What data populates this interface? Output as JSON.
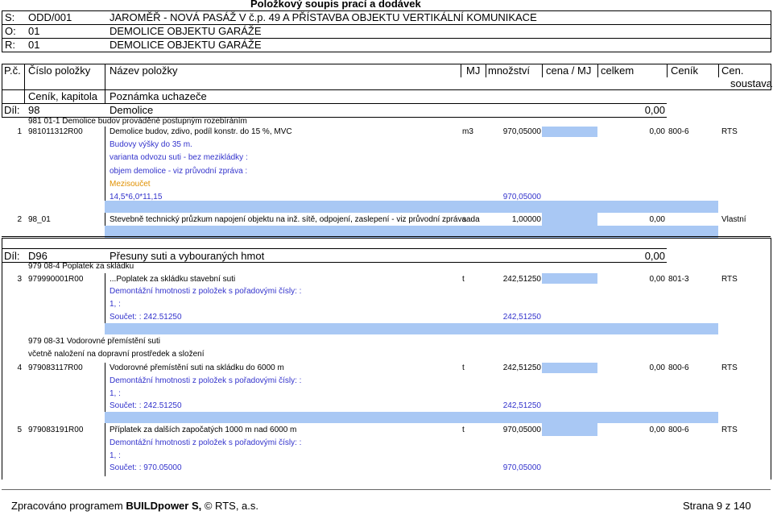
{
  "title": "Položkový soupis prací a dodávek",
  "header": {
    "s_label": "S:",
    "s_code": "ODD/001",
    "s_name": "JAROMĚŘ - NOVÁ PASÁŽ V č.p. 49 A PŘÍSTAVBA OBJEKTU VERTIKÁLNÍ KOMUNIKACE",
    "o_label": "O:",
    "o_code": "01",
    "o_name": "DEMOLICE OBJEKTU GARÁŽE",
    "r_label": "R:",
    "r_code": "01",
    "r_name": "DEMOLICE OBJEKTU GARÁŽE"
  },
  "columns": {
    "pc": "P.č.",
    "cislo": "Číslo položky",
    "nazev": "Název položky",
    "mj": "MJ",
    "mnozstvi": "množství",
    "cena": "cena / MJ",
    "celkem": "celkem",
    "cenik": "Ceník",
    "cen_soustava_1": "Cen.",
    "cen_soustava_2": "soustava",
    "cenik_kapitola": "Ceník, kapitola",
    "poznamka": "Poznámka uchazeče"
  },
  "dil1": {
    "label": "Díl:",
    "code": "98",
    "name": "Demolice",
    "total": "0,00"
  },
  "dil2": {
    "label": "Díl:",
    "code": "D96",
    "name": "Přesuny suti a vybouraných hmot",
    "total": "0,00"
  },
  "items": {
    "c981": "981 01-1 Demolice budov prováděné postupným rozebíráním",
    "i1": {
      "pc": "1",
      "code": "981011312R00",
      "name": "Demolice budov, zdivo, podíl konstr. do 15 %, MVC",
      "mj": "m3",
      "qty": "970,05000",
      "total": "0,00",
      "cenik": "800-6",
      "sous": "RTS"
    },
    "i1_n1": "Budovy výšky do 35 m.",
    "i1_n2": "varianta odvozu suti - bez mezikládky :",
    "i1_n3": "objem demolice - viz průvodní zpráva :",
    "i1_n4": "Mezisoučet",
    "i1_n5": "14,5*6,0*11,15",
    "i1_n5_qty": "970,05000",
    "i2": {
      "pc": "2",
      "code": "98_01",
      "name": "Stevebně technický průzkum napojení objektu na inž. sítě, odpojení, zaslepení - viz průvodní zpráva",
      "mj": "sada",
      "qty": "1,00000",
      "total": "0,00",
      "sous": "Vlastní"
    },
    "c979": "979 08-4 Poplatek za skládku",
    "i3": {
      "pc": "3",
      "code": "979990001R00",
      "name": "...Poplatek za skládku stavební suti",
      "mj": "t",
      "qty": "242,51250",
      "total": "0,00",
      "cenik": "801-3",
      "sous": "RTS"
    },
    "i3_n1": "Demontážní hmotnosti z položek s pořadovými čísly: :",
    "i3_n2": "1, :",
    "i3_n3": "Součet: : 242.51250",
    "i3_n3_qty": "242,51250",
    "c97931a": "979 08-31 Vodorovné přemístění suti",
    "c97931b": "včetně naložení na dopravní prostředek a složení",
    "i4": {
      "pc": "4",
      "code": "979083117R00",
      "name": "Vodorovné přemístění suti na skládku do 6000 m",
      "mj": "t",
      "qty": "242,51250",
      "total": "0,00",
      "cenik": "800-6",
      "sous": "RTS"
    },
    "i4_n1": "Demontážní hmotnosti z položek s pořadovými čísly: :",
    "i4_n2": "1, :",
    "i4_n3": "Součet: : 242.51250",
    "i4_n3_qty": "242,51250",
    "i5": {
      "pc": "5",
      "code": "979083191R00",
      "name": "Příplatek za dalších započatých 1000 m nad 6000 m",
      "mj": "t",
      "qty": "970,05000",
      "total": "0,00",
      "cenik": "800-6",
      "sous": "RTS"
    },
    "i5_n1": "Demontážní hmotnosti z položek s pořadovými čísly: :",
    "i5_n2": "1, :",
    "i5_n3": "Součet: : 970.05000",
    "i5_n3_qty": "970,05000"
  },
  "footer": {
    "program_prefix": "Zpracováno programem ",
    "program_name": "BUILDpower S,",
    "program_suffix": "  © RTS, a.s.",
    "page": "Strana 9 z 140"
  }
}
